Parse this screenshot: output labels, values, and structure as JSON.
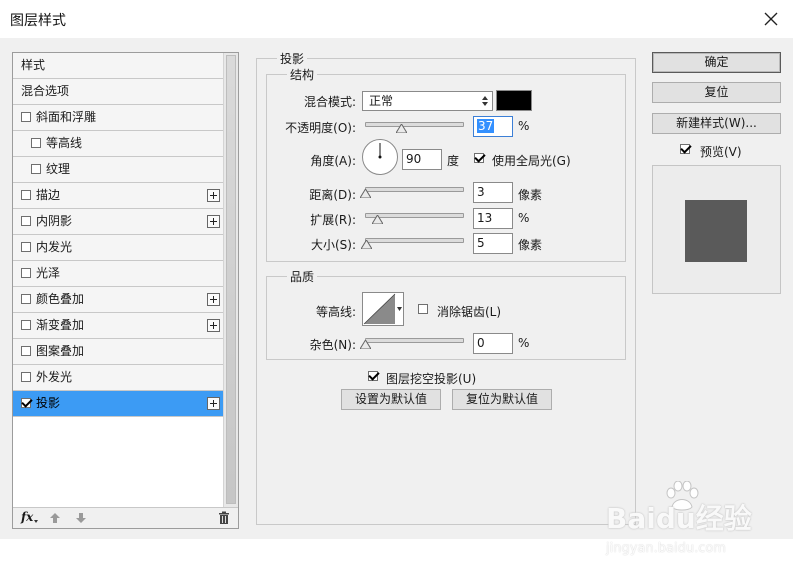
{
  "window": {
    "title": "图层样式"
  },
  "style_list": {
    "items": [
      {
        "label": "样式",
        "checkbox": false,
        "checked": false,
        "indent": false,
        "add": false,
        "selected": false
      },
      {
        "label": "混合选项",
        "checkbox": false,
        "checked": false,
        "indent": false,
        "add": false,
        "selected": false
      },
      {
        "label": "斜面和浮雕",
        "checkbox": true,
        "checked": false,
        "indent": false,
        "add": false,
        "selected": false
      },
      {
        "label": "等高线",
        "checkbox": true,
        "checked": false,
        "indent": true,
        "add": false,
        "selected": false
      },
      {
        "label": "纹理",
        "checkbox": true,
        "checked": false,
        "indent": true,
        "add": false,
        "selected": false
      },
      {
        "label": "描边",
        "checkbox": true,
        "checked": false,
        "indent": false,
        "add": true,
        "selected": false
      },
      {
        "label": "内阴影",
        "checkbox": true,
        "checked": false,
        "indent": false,
        "add": true,
        "selected": false
      },
      {
        "label": "内发光",
        "checkbox": true,
        "checked": false,
        "indent": false,
        "add": false,
        "selected": false
      },
      {
        "label": "光泽",
        "checkbox": true,
        "checked": false,
        "indent": false,
        "add": false,
        "selected": false
      },
      {
        "label": "颜色叠加",
        "checkbox": true,
        "checked": false,
        "indent": false,
        "add": true,
        "selected": false
      },
      {
        "label": "渐变叠加",
        "checkbox": true,
        "checked": false,
        "indent": false,
        "add": true,
        "selected": false
      },
      {
        "label": "图案叠加",
        "checkbox": true,
        "checked": false,
        "indent": false,
        "add": false,
        "selected": false
      },
      {
        "label": "外发光",
        "checkbox": true,
        "checked": false,
        "indent": false,
        "add": false,
        "selected": false
      },
      {
        "label": "投影",
        "checkbox": true,
        "checked": true,
        "indent": false,
        "add": true,
        "selected": true
      }
    ],
    "footer": {
      "fx_label": "fx"
    }
  },
  "drop_shadow": {
    "title": "投影",
    "structure": {
      "title": "结构",
      "blend_mode_label": "混合模式:",
      "blend_mode_value": "正常",
      "shadow_color": "#000000",
      "opacity_label": "不透明度(O):",
      "opacity_value": "37",
      "opacity_unit": "%",
      "opacity_fraction": 0.37,
      "angle_label": "角度(A):",
      "angle_value": "90",
      "angle_unit": "度",
      "global_light_label": "使用全局光(G)",
      "global_light_checked": true,
      "distance_label": "距离(D):",
      "distance_value": "3",
      "distance_unit": "像素",
      "distance_fraction": 0.01,
      "spread_label": "扩展(R):",
      "spread_value": "13",
      "spread_unit": "%",
      "spread_fraction": 0.13,
      "size_label": "大小(S):",
      "size_value": "5",
      "size_unit": "像素",
      "size_fraction": 0.02
    },
    "quality": {
      "title": "品质",
      "contour_label": "等高线:",
      "anti_alias_label": "消除锯齿(L)",
      "anti_alias_checked": false,
      "noise_label": "杂色(N):",
      "noise_value": "0",
      "noise_unit": "%",
      "noise_fraction": 0.0
    },
    "knockout_label": "图层挖空投影(U)",
    "knockout_checked": true,
    "make_default_label": "设置为默认值",
    "reset_default_label": "复位为默认值"
  },
  "right_panel": {
    "ok_label": "确定",
    "reset_label": "复位",
    "new_style_label": "新建样式(W)...",
    "preview_label": "预览(V)",
    "preview_checked": true
  },
  "watermark": {
    "brand": "Baidu经验",
    "url": "jingyan.baidu.com"
  },
  "colors": {
    "selection": "#3c9bf4",
    "preview_square": "#5a5a5a"
  }
}
